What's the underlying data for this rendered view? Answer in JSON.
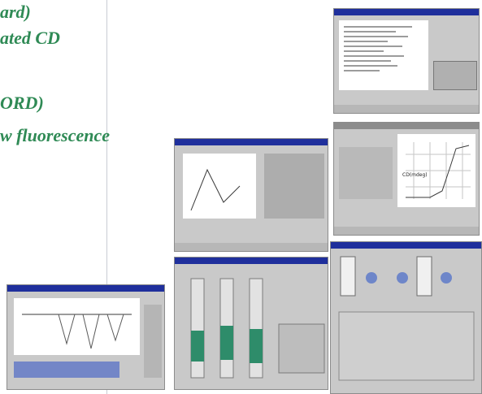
{
  "headline": {
    "lines": [
      "ard)",
      "ated CD",
      "ORD)",
      "w fluorescence"
    ]
  },
  "screenshots": {
    "top_right_1": {
      "title": "",
      "mode": "text-list"
    },
    "top_right_2": {
      "title": "",
      "mode": "plot-cd",
      "plot_label": "CD(mdeg)"
    },
    "middle_1": {
      "title": "",
      "mode": "dialog-plot"
    },
    "middle_2": {
      "title": "",
      "mode": "sliders"
    },
    "bottom_left": {
      "title": "",
      "mode": "spectrum"
    },
    "bottom_right": {
      "title": "",
      "mode": "controls"
    }
  },
  "colors": {
    "accent_text": "#2f8a55",
    "window_titlebar": "#1f2f9c",
    "panel_bg": "#c9c9c9"
  }
}
